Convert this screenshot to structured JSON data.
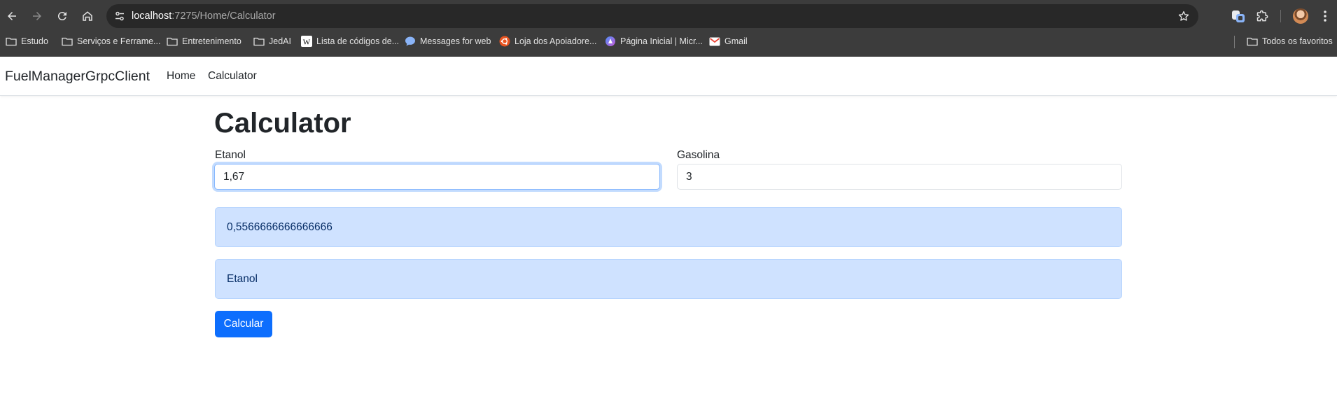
{
  "browser": {
    "url_host": "localhost",
    "url_path": ":7275/Home/Calculator",
    "icons": {
      "back": "arrow-left-icon",
      "forward": "arrow-right-icon",
      "reload": "reload-icon",
      "home": "home-icon",
      "site_settings": "tune-icon",
      "bookmark_star": "star-icon",
      "extension_a": "copilot-icon",
      "extensions": "puzzle-icon",
      "profile": "avatar",
      "menu": "kebab-menu-icon"
    },
    "bookmarks": [
      {
        "label": "Estudo",
        "icon": "folder-icon"
      },
      {
        "label": "Serviços e Ferrame...",
        "icon": "folder-icon"
      },
      {
        "label": "Entretenimento",
        "icon": "folder-icon"
      },
      {
        "label": "JedAI",
        "icon": "folder-icon"
      },
      {
        "label": "Lista de códigos de...",
        "icon": "wikipedia-icon"
      },
      {
        "label": "Messages for web",
        "icon": "messages-icon"
      },
      {
        "label": "Loja dos Apoiadore...",
        "icon": "ubuntu-icon"
      },
      {
        "label": "Página Inicial | Micr...",
        "icon": "microsoft-icon"
      },
      {
        "label": "Gmail",
        "icon": "gmail-icon"
      }
    ],
    "all_bookmarks_label": "Todos os favoritos"
  },
  "navbar": {
    "brand": "FuelManagerGrpcClient",
    "links": [
      "Home",
      "Calculator"
    ]
  },
  "page": {
    "title": "Calculator",
    "etanol_label": "Etanol",
    "etanol_value": "1,67",
    "gasolina_label": "Gasolina",
    "gasolina_value": "3",
    "result_ratio": "0,5566666666666666",
    "result_choice": "Etanol",
    "submit_label": "Calcular"
  },
  "colors": {
    "chrome_bg": "#3c3c3c",
    "omnibox_bg": "#282828",
    "primary": "#0d6efd",
    "alert_bg": "#cfe2ff",
    "alert_text": "#052c65"
  }
}
